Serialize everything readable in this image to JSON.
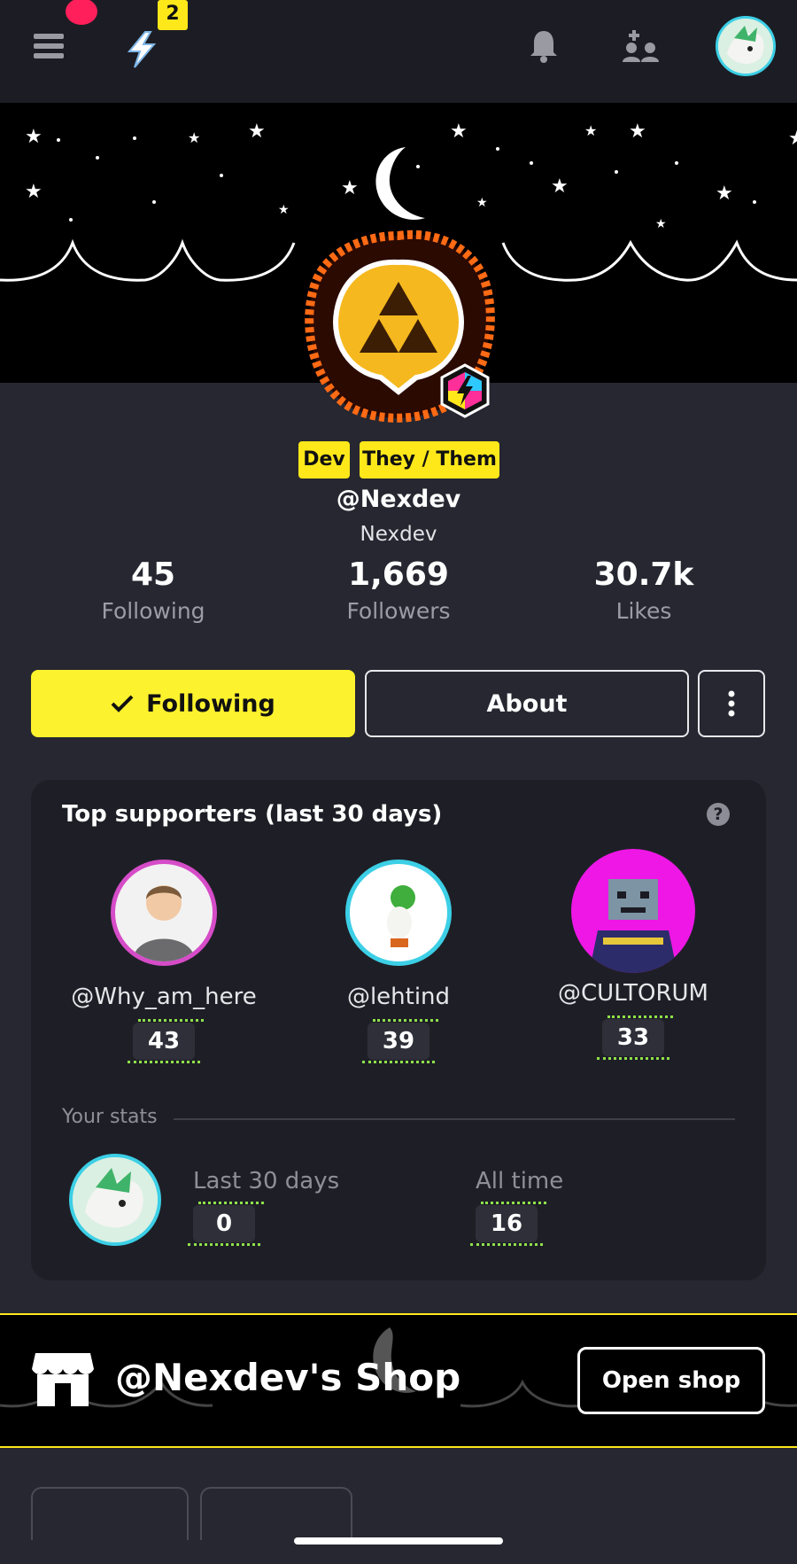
{
  "topbar": {
    "notification_badge": "2",
    "icons": [
      "menu-icon",
      "bolt-icon",
      "bell-icon",
      "people-icon",
      "user-avatar"
    ]
  },
  "profile": {
    "tags": [
      "Dev",
      "They / Them"
    ],
    "handle": "@Nexdev",
    "display_name": "Nexdev",
    "stats": [
      {
        "value": "45",
        "label": "Following"
      },
      {
        "value": "1,669",
        "label": "Followers"
      },
      {
        "value": "30.7k",
        "label": "Likes"
      }
    ]
  },
  "actions": {
    "following_label": "Following",
    "about_label": "About"
  },
  "supporters": {
    "title": "Top supporters (last 30 days)",
    "help": "?",
    "items": [
      {
        "name": "@Why_am_here",
        "score": "43"
      },
      {
        "name": "@lehtind",
        "score": "39"
      },
      {
        "name": "@CULTORUM",
        "score": "33"
      }
    ]
  },
  "your_stats": {
    "label": "Your stats",
    "last30_label": "Last 30 days",
    "last30_value": "0",
    "alltime_label": "All time",
    "alltime_value": "16"
  },
  "shop": {
    "title": "@Nexdev's Shop",
    "open_label": "Open shop"
  },
  "colors": {
    "accent": "#fdf22e",
    "background": "#262730",
    "card": "#1e1f26",
    "record_dot": "#ff1f5a",
    "avatar_ring": "#3ccfe6"
  }
}
